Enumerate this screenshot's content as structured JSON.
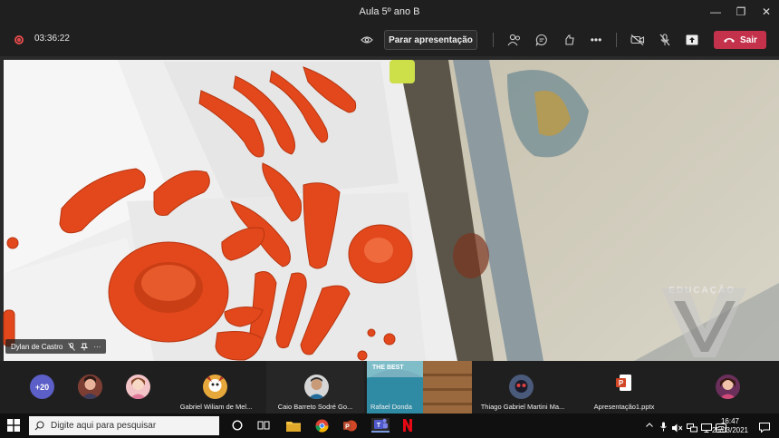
{
  "window": {
    "title": "Aula 5º ano B",
    "minimize_glyph": "—",
    "maximize_glyph": "❐",
    "close_glyph": "✕"
  },
  "toolbar": {
    "recording_time": "03:36:22",
    "stop_presenting_label": "Parar apresentação",
    "more_glyph": "•••",
    "leave_label": "Sair"
  },
  "main_video": {
    "presenter_name": "Dylan de Castro",
    "more_glyph": "···",
    "watermark_text": "EDUCAÇÃO"
  },
  "participants": {
    "more_count": "+20",
    "tiles": [
      {
        "label": "Gabriel Wiliam de Mel..."
      },
      {
        "label": "Caio Barreto Sodré Go..."
      },
      {
        "label": "Rafael Donda"
      },
      {
        "label": "Thiago Gabriel Martini Ma..."
      },
      {
        "label": "Apresentação1.pptx"
      }
    ],
    "rafael_shirt_text": "THE BEST"
  },
  "taskbar": {
    "search_placeholder": "Digite aqui para pesquisar",
    "time": "16:47",
    "date": "25/03/2021"
  },
  "colors": {
    "leave_button": "#c4314b",
    "more_badge": "#5b5fc7",
    "recording": "#e04a4a",
    "clay": "#e2481c"
  }
}
